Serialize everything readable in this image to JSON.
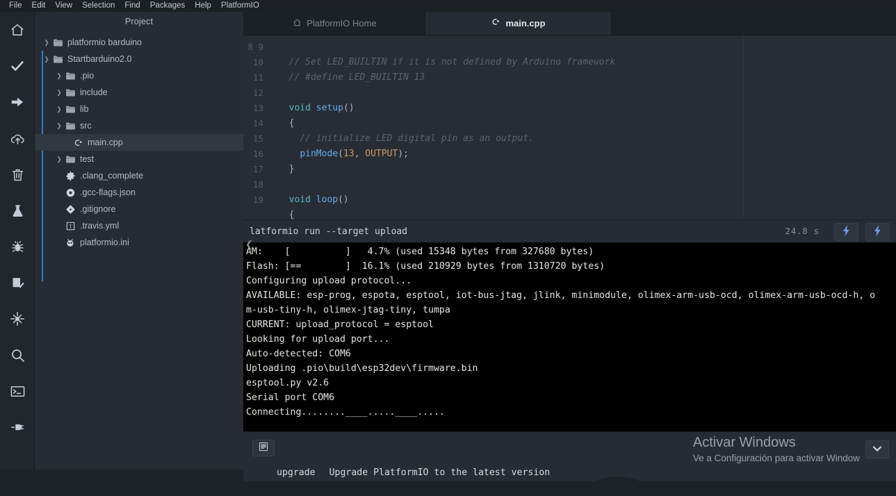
{
  "menubar": {
    "items": [
      {
        "label": "File"
      },
      {
        "label": "Edit"
      },
      {
        "label": "View"
      },
      {
        "label": "Selection"
      },
      {
        "label": "Find"
      },
      {
        "label": "Packages"
      },
      {
        "label": "Help"
      },
      {
        "label": "PlatformIO"
      }
    ]
  },
  "rail": {
    "items": [
      {
        "name": "home-icon",
        "title": "PlatformIO Home"
      },
      {
        "name": "check-icon",
        "title": "Build"
      },
      {
        "name": "arrow-right-icon",
        "title": "Upload"
      },
      {
        "name": "cloud-upload-icon",
        "title": "Upload to remote"
      },
      {
        "name": "trash-icon",
        "title": "Clean"
      },
      {
        "name": "flask-icon",
        "title": "Test"
      },
      {
        "name": "bug-icon",
        "title": "Debug"
      },
      {
        "name": "clipboard-check-icon",
        "title": "Check"
      },
      {
        "name": "settings-sliders-icon",
        "title": "Settings"
      },
      {
        "name": "search-icon",
        "title": "Search"
      },
      {
        "name": "terminal-icon",
        "title": "Terminal"
      },
      {
        "name": "plug-icon",
        "title": "Serial Monitor"
      }
    ]
  },
  "tree": {
    "header": "Project",
    "items": [
      {
        "label": "platformio barduino",
        "depth": 0,
        "type": "folder",
        "state": "collapsed"
      },
      {
        "label": "Startbarduino2.0",
        "depth": 0,
        "type": "folder",
        "state": "expanded"
      },
      {
        "label": ".pio",
        "depth": 1,
        "type": "folder",
        "state": "collapsed"
      },
      {
        "label": "include",
        "depth": 1,
        "type": "folder",
        "state": "collapsed"
      },
      {
        "label": "lib",
        "depth": 1,
        "type": "folder",
        "state": "collapsed"
      },
      {
        "label": "src",
        "depth": 1,
        "type": "folder",
        "state": "expanded"
      },
      {
        "label": "main.cpp",
        "depth": 2,
        "type": "cpp",
        "state": "selected"
      },
      {
        "label": "test",
        "depth": 1,
        "type": "folder",
        "state": "collapsed"
      },
      {
        "label": ".clang_complete",
        "depth": 1,
        "type": "gear",
        "state": "file"
      },
      {
        "label": ".gcc-flags.json",
        "depth": 1,
        "type": "json",
        "state": "file"
      },
      {
        "label": ".gitignore",
        "depth": 1,
        "type": "git",
        "state": "file"
      },
      {
        "label": ".travis.yml",
        "depth": 1,
        "type": "yml",
        "state": "file"
      },
      {
        "label": "platformio.ini",
        "depth": 1,
        "type": "ini",
        "state": "file"
      }
    ]
  },
  "tabs": [
    {
      "label": "PlatformIO Home",
      "icon": "home-icon",
      "active": false
    },
    {
      "label": "main.cpp",
      "icon": "cpp-icon",
      "active": true
    }
  ],
  "editor": {
    "first_line_number": 8,
    "lines": [
      {
        "n": 8,
        "text": ""
      },
      {
        "n": 9,
        "text": "  // Set LED_BUILTIN if it is not defined by Arduino framework"
      },
      {
        "n": 10,
        "text": "  // #define LED_BUILTIN 13"
      },
      {
        "n": 11,
        "text": ""
      },
      {
        "n": 12,
        "text": "  void setup()"
      },
      {
        "n": 13,
        "text": "  {"
      },
      {
        "n": 14,
        "text": "    // initialize LED digital pin as an output."
      },
      {
        "n": 15,
        "text": "    pinMode(13, OUTPUT);"
      },
      {
        "n": 16,
        "text": "  }"
      },
      {
        "n": 17,
        "text": ""
      },
      {
        "n": 18,
        "text": "  void loop()"
      },
      {
        "n": 19,
        "text": "  {"
      }
    ]
  },
  "terminal": {
    "title": "latformio run --target upload",
    "elapsed": "24.8 s",
    "buttons": [
      {
        "name": "run-lightning-button",
        "icon": "lightning-icon"
      },
      {
        "name": "secondary-button",
        "icon": "lightning-icon"
      }
    ],
    "collapse_icon": "chevron-left-icon",
    "output": "AM:    [          ]   4.7% (used 15348 bytes from 327680 bytes)\nFlash: [==        ]  16.1% (used 210929 bytes from 1310720 bytes)\nConfiguring upload protocol...\nAVAILABLE: esp-prog, espota, esptool, iot-bus-jtag, jlink, minimodule, olimex-arm-usb-ocd, olimex-arm-usb-ocd-h, o\nm-usb-tiny-h, olimex-jtag-tiny, tumpa\nCURRENT: upload_protocol = esptool\nLooking for upload port...\nAuto-detected: COM6\nUploading .pio\\build\\esp32dev\\firmware.bin\nesptool.py v2.6\nSerial port COM6\nConnecting........____.....____....."
  },
  "bottom": {
    "toggle_icon": "list-lines-icon",
    "upgrade_key": "upgrade",
    "upgrade_desc": "Upgrade PlatformIO to the latest version",
    "dropdown_icon": "chevron-down-icon"
  },
  "watermark": {
    "title": "Activar Windows",
    "subtitle": "Ve a Configuración para activar Window"
  },
  "colors": {
    "menubar_bg": "#1c2025",
    "rail_bg": "#22272e",
    "tree_bg": "#272c34",
    "editor_bg": "#282c34",
    "terminal_bg": "#000000",
    "accent_blue": "#2f7ecb",
    "lightning_blue": "#5a8fe0",
    "selection_bg": "#32383f"
  }
}
